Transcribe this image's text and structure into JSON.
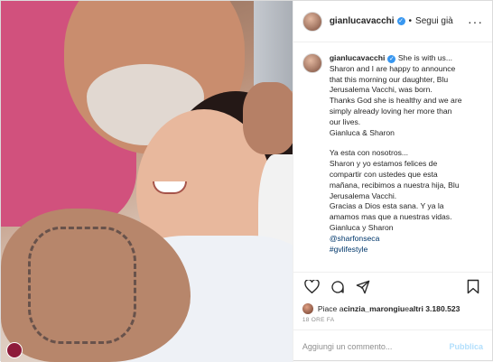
{
  "header": {
    "username": "gianlucavacchi",
    "separator": "•",
    "follow_label": "Segui già",
    "more_label": "···"
  },
  "caption": {
    "username": "gianlucavacchi",
    "lines": [
      "She is with us...",
      "Sharon and I are happy to announce",
      "that this morning our daughter, Blu",
      "Jerusalema Vacchi, was born.",
      "Thanks God she is healthy and we are",
      "simply already loving her more than",
      "our lives.",
      "Gianluca & Sharon",
      "",
      "Ya esta con nosotros...",
      "Sharon y yo estamos felices de",
      "compartir con ustedes que esta",
      "mañana, recibimos a nuestra hija, Blu",
      "Jerusalema Vacchi.",
      "Gracias a Dios esta sana. Y ya la",
      "amamos mas que a nuestras vidas.",
      "Gianluca y Sharon"
    ],
    "mention": "@sharfonseca",
    "hashtag": "#gvlifestyle"
  },
  "actions": {
    "like": "heart-icon",
    "comment": "comment-icon",
    "share": "share-icon",
    "save": "bookmark-icon"
  },
  "likes": {
    "prefix": "Piace a ",
    "user": "cinzia_marongiu",
    "middle": " e ",
    "others": "altri 3.180.523"
  },
  "timestamp": "18 ORE FA",
  "comment_box": {
    "placeholder": "Aggiungi un commento...",
    "publish_label": "Pubblica"
  },
  "colors": {
    "verified": "#3897f0",
    "link": "#00376b",
    "publish_disabled": "#b2dffc",
    "shirt": "#d1517d"
  }
}
